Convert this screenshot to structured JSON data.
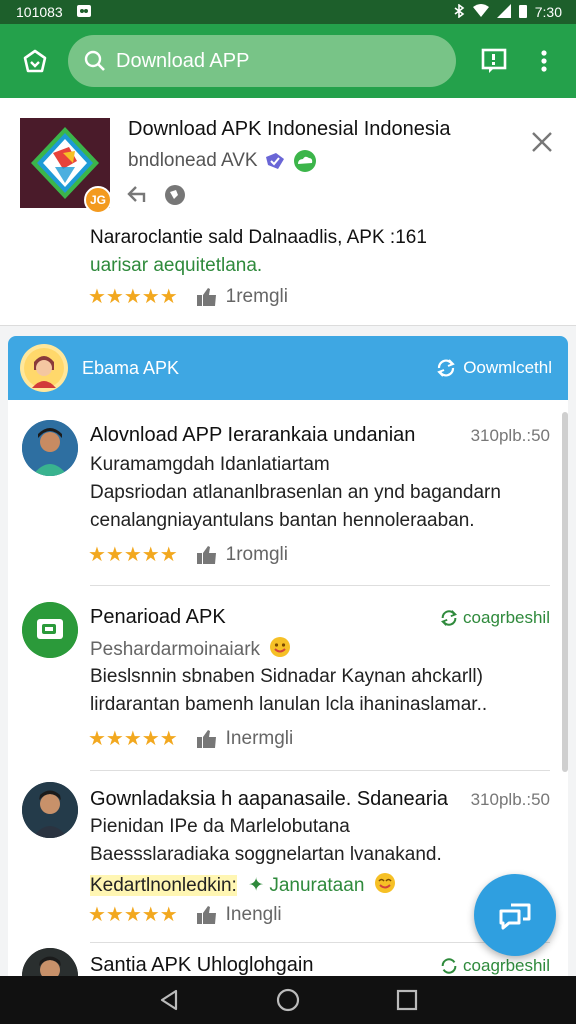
{
  "status_bar": {
    "left_text": "101083",
    "time": "7:30"
  },
  "search": {
    "placeholder": "Download APP"
  },
  "top_card": {
    "title": "Download APK Indonesial Indonesia",
    "subtitle": "bndlonead AVK",
    "badge": "JG",
    "desc_line1": "Nararoclantie sald Dalnaadlis, APK :161",
    "desc_line2": "uarisar aequitetlana.",
    "rating_text": "1remgli"
  },
  "panel": {
    "title": "Ebama APK",
    "action": "Oowmlcethl"
  },
  "items": [
    {
      "title": "Alovnload APP Ierarankaia undanian",
      "meta": "310plb.:50",
      "line1": "Kuramamgdah Idanlatiartam",
      "line2": "Dapsriodan atlananlbrasenlan an ynd bagandarn",
      "line3": "cenalangniayantulans bantan hennoleraaban.",
      "rating_text": "1romgli"
    },
    {
      "title": "Penarioad APK",
      "meta": "coagrbeshil",
      "line1": "Peshardarmoinaiark",
      "line2": "Bieslsnnin sbnaben Sidnadar Kaynan ahckarll)",
      "line3": "lirdarantan bamenh lanulan lcla ihaninaslamar..",
      "rating_text": "Inermgli"
    },
    {
      "title": "Gownladaksia h aapanasaile. Sdanearia",
      "meta": "310plb.:50",
      "line1": "Pienidan IPe da Marlelobutana",
      "line2": "Baessslaradiaka soggnelartan lvanakand.",
      "line3_prefix": "Kedartlnonledkin:",
      "line3_green": "Janurataan",
      "rating_text": "Inengli"
    },
    {
      "title": "Santia APK Uhloglohgain",
      "meta": "coagrbeshil"
    }
  ],
  "colors": {
    "status_bar": "#1d5f2b",
    "app_bar": "#24a14b",
    "panel_header": "#3ea7e3",
    "star": "#f2a81f",
    "green_text": "#2f8a3c",
    "fab": "#2f9fe0"
  },
  "icons": {
    "home": "home-icon",
    "search": "search-icon",
    "feedback": "feedback-icon",
    "more": "more-vert-icon",
    "close": "close-icon",
    "share": "share-icon",
    "globe": "globe-icon",
    "thumb": "thumb-up-icon",
    "sync": "sync-icon",
    "fab": "chat-icon",
    "back": "back-icon",
    "home_nav": "home-nav-icon",
    "recents": "recents-icon"
  }
}
